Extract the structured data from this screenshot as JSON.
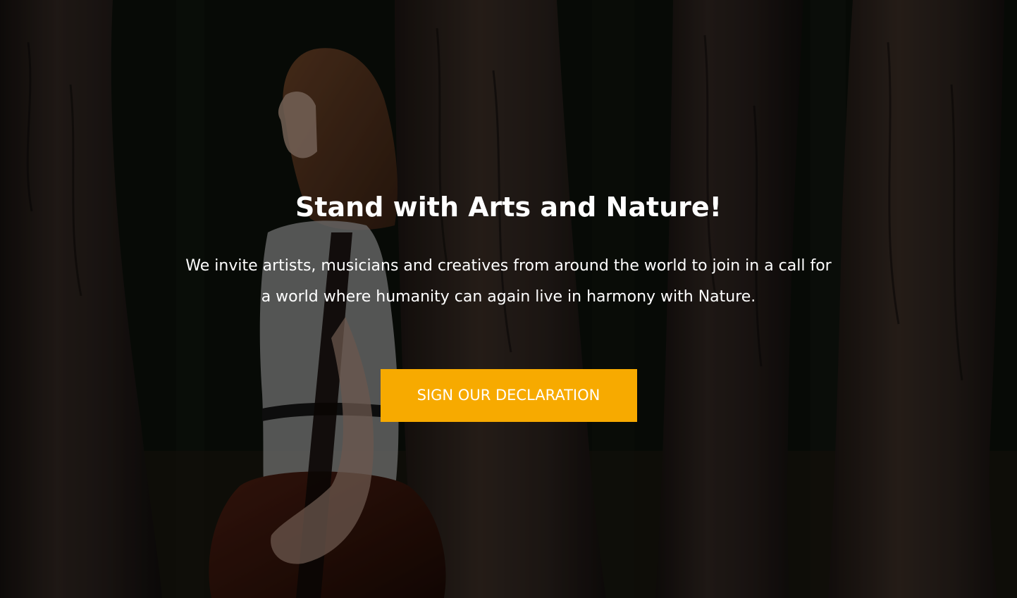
{
  "hero": {
    "headline": "Stand with Arts and Nature!",
    "subtext": "We invite artists, musicians and creatives from around the world to join in a call for a world where humanity can again live in harmony with Nature.",
    "cta_label": "SIGN OUR DECLARATION"
  },
  "colors": {
    "accent": "#f7aa00",
    "text": "#ffffff",
    "background": "#111710"
  }
}
